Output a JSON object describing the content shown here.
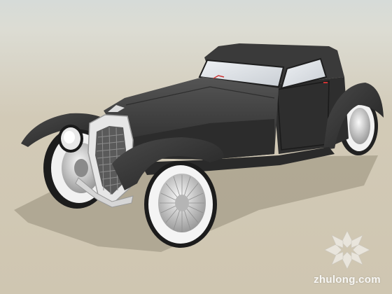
{
  "viewport": {
    "name": "3d-model-viewport",
    "model": "vintage-coupe-car-model"
  },
  "colors": {
    "sky": "#d6dbd8",
    "ground": "#cfc6b1",
    "body": "#3b3b3b",
    "body_dark": "#262626",
    "chrome": "#d8d8d8",
    "whitewall": "#f4f4f4",
    "window": "#dfe4ea"
  },
  "watermark": {
    "text": "zhulong.com",
    "icon": "flower-logo-icon"
  }
}
